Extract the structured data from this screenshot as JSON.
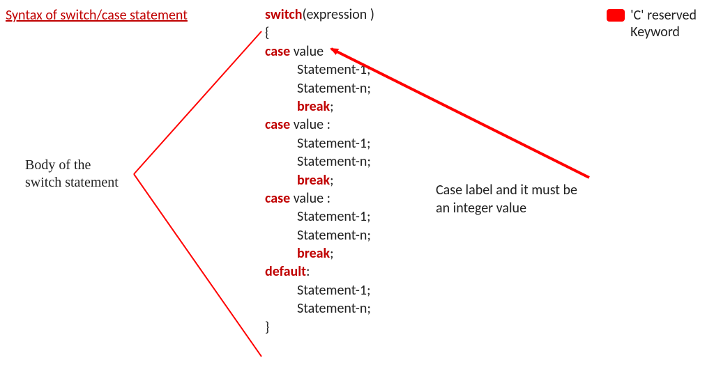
{
  "title": "Syntax of switch/case statement",
  "legend": {
    "line1": "'C' reserved",
    "line2": "Keyword"
  },
  "body_label": {
    "line1": "Body of the",
    "line2": "switch statement"
  },
  "case_label": {
    "line1": "Case label and it must be",
    "line2": "an integer value"
  },
  "code": {
    "kw_switch": "switch",
    "txt_expr": "(expression )",
    "brace_open": "{",
    "kw_case": "case",
    "txt_value_first": " value",
    "txt_value_colon": " value :",
    "txt_stmt1": "Statement-1;",
    "txt_stmtn": "Statement-n;",
    "kw_break": "break",
    "txt_semi": ";",
    "kw_default": "default",
    "txt_colon": ":",
    "brace_close": "}"
  },
  "colors": {
    "red": "#ff0000",
    "kw_red": "#c00000"
  }
}
